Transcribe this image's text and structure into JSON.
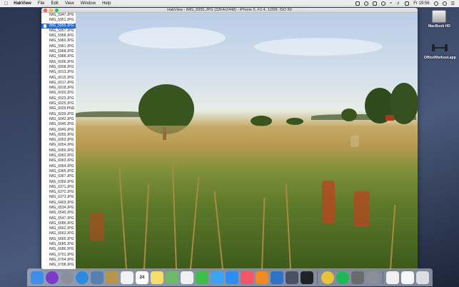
{
  "menubar": {
    "app_name": "HakView",
    "menus": [
      "File",
      "Edit",
      "View",
      "Window",
      "Help"
    ],
    "clock": "Fr 19:56"
  },
  "desktop": {
    "icons": [
      {
        "label": "MacBook HD"
      },
      {
        "label": "OfficeWorkout.app"
      }
    ]
  },
  "window": {
    "title": "HakView - IMG_5955.JPG (3264x2448) - iPhone 5, F2.4, 1/399, ISO 50",
    "selected_file": "IMG_5955.JPG",
    "files": [
      "IMG_5947.JPG",
      "IMG_5951.JPG",
      "IMG_5955.JPG",
      "IMG_5957.JPG",
      "IMG_5958.JPG",
      "IMG_5960.JPG",
      "IMG_5961.JPG",
      "IMG_5968.JPG",
      "IMG_5988.JPG",
      "IMG_6006.JPG",
      "IMG_6008.JPG",
      "IMG_6013.JPG",
      "IMG_6015.JPG",
      "IMG_6017.JPG",
      "IMG_6018.JPG",
      "IMG_6020.JPG",
      "IMG_6023.JPG",
      "IMG_6025.JPG",
      "IMG_6029.PNG",
      "IMG_6039.JPG",
      "IMG_6042.JPG",
      "IMG_6045.JPG",
      "IMG_6049.JPG",
      "IMG_6050.JPG",
      "IMG_6053.JPG",
      "IMG_6054.JPG",
      "IMG_6059.JPG",
      "IMG_6062.JPG",
      "IMG_6063.JPG",
      "IMG_6064.JPG",
      "IMG_6365.JPG",
      "IMG_6367.JPG",
      "IMG_6369.JPG",
      "IMG_6371.JPG",
      "IMG_6372.JPG",
      "IMG_6373.JPG",
      "IMG_6403.JPG",
      "IMG_6534.JPG",
      "IMG_6540.JPG",
      "IMG_6547.JPG",
      "IMG_6586.JPG",
      "IMG_6662.JPG",
      "IMG_6663.JPG",
      "IMG_6665.JPG",
      "IMG_6685.JPG",
      "IMG_6686.JPG",
      "IMG_6701.JPG",
      "IMG_6704.JPG",
      "IMG_6708.JPG"
    ]
  },
  "dock": {
    "apps": [
      {
        "name": "finder",
        "color": "#3d8ee8"
      },
      {
        "name": "siri",
        "color": "#7a3cc8"
      },
      {
        "name": "launchpad",
        "color": "#8a8f99"
      },
      {
        "name": "safari",
        "color": "#2a8ae0"
      },
      {
        "name": "preview",
        "color": "#5580b0"
      },
      {
        "name": "notefile",
        "color": "#b8954c"
      },
      {
        "name": "reminders",
        "color": "#f2f2f2"
      },
      {
        "name": "calendar",
        "color": "#ffffff"
      },
      {
        "name": "notes",
        "color": "#f5dd6a"
      },
      {
        "name": "maps",
        "color": "#6dbb6a"
      },
      {
        "name": "photos",
        "color": "#f0f0f0"
      },
      {
        "name": "facetime",
        "color": "#3dbd4a"
      },
      {
        "name": "messages",
        "color": "#3ea3f2"
      },
      {
        "name": "app-store",
        "color": "#2f8cf0"
      },
      {
        "name": "music",
        "color": "#f5556a"
      },
      {
        "name": "books",
        "color": "#f08a22"
      },
      {
        "name": "xcode",
        "color": "#2e73c8"
      },
      {
        "name": "simulator",
        "color": "#4a5060"
      },
      {
        "name": "terminal",
        "color": "#222222"
      },
      {
        "name": "chrome",
        "color": "#e8c33a"
      },
      {
        "name": "spotify",
        "color": "#1db954"
      },
      {
        "name": "photo-app",
        "color": "#6b6b6b"
      },
      {
        "name": "system-preferences",
        "color": "#8a8f99"
      },
      {
        "name": "document",
        "color": "#f0f0f0"
      },
      {
        "name": "downloads",
        "color": "#f6f6f6"
      },
      {
        "name": "trash",
        "color": "#dadde3"
      }
    ],
    "calendar_day": "24"
  }
}
